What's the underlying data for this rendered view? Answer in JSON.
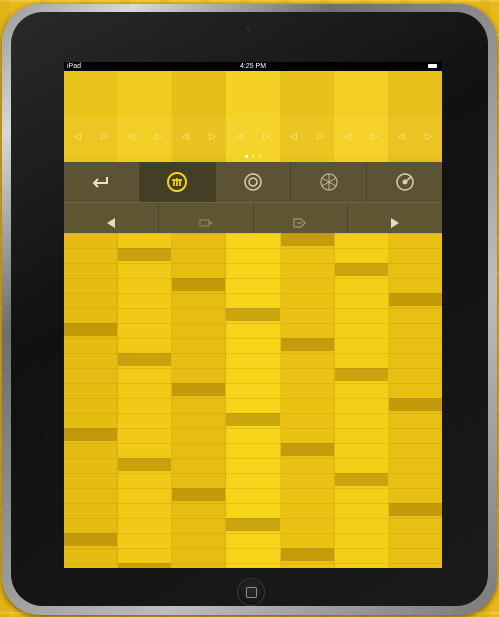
{
  "statusbar": {
    "carrier": "iPad",
    "time": "4:25 PM"
  },
  "arrows": [
    "◁",
    "▷",
    "◁",
    "▷",
    "◁",
    "▷",
    "◁",
    "▷",
    "◁",
    "▷",
    "◁",
    "▷",
    "◁",
    "▷"
  ],
  "toolbar": {
    "tools": [
      {
        "name": "undo-icon",
        "glyph": "↵",
        "active": false
      },
      {
        "name": "hand-icon",
        "glyph": "✋",
        "active": true
      },
      {
        "name": "record-icon",
        "glyph": "◎",
        "active": false
      },
      {
        "name": "shape-icon",
        "glyph": "✺",
        "active": false
      },
      {
        "name": "disc-icon",
        "glyph": "◉",
        "active": false
      }
    ],
    "nav": [
      {
        "name": "previous-icon",
        "glyph": "◀"
      },
      {
        "name": "view-icon",
        "glyph": "▭"
      },
      {
        "name": "export-icon",
        "glyph": "⇨"
      },
      {
        "name": "next-icon",
        "glyph": "▶"
      }
    ]
  },
  "colors": {
    "accent": "#f5d21a",
    "toolbar": "#5b5333",
    "background": "#e8b81c"
  }
}
